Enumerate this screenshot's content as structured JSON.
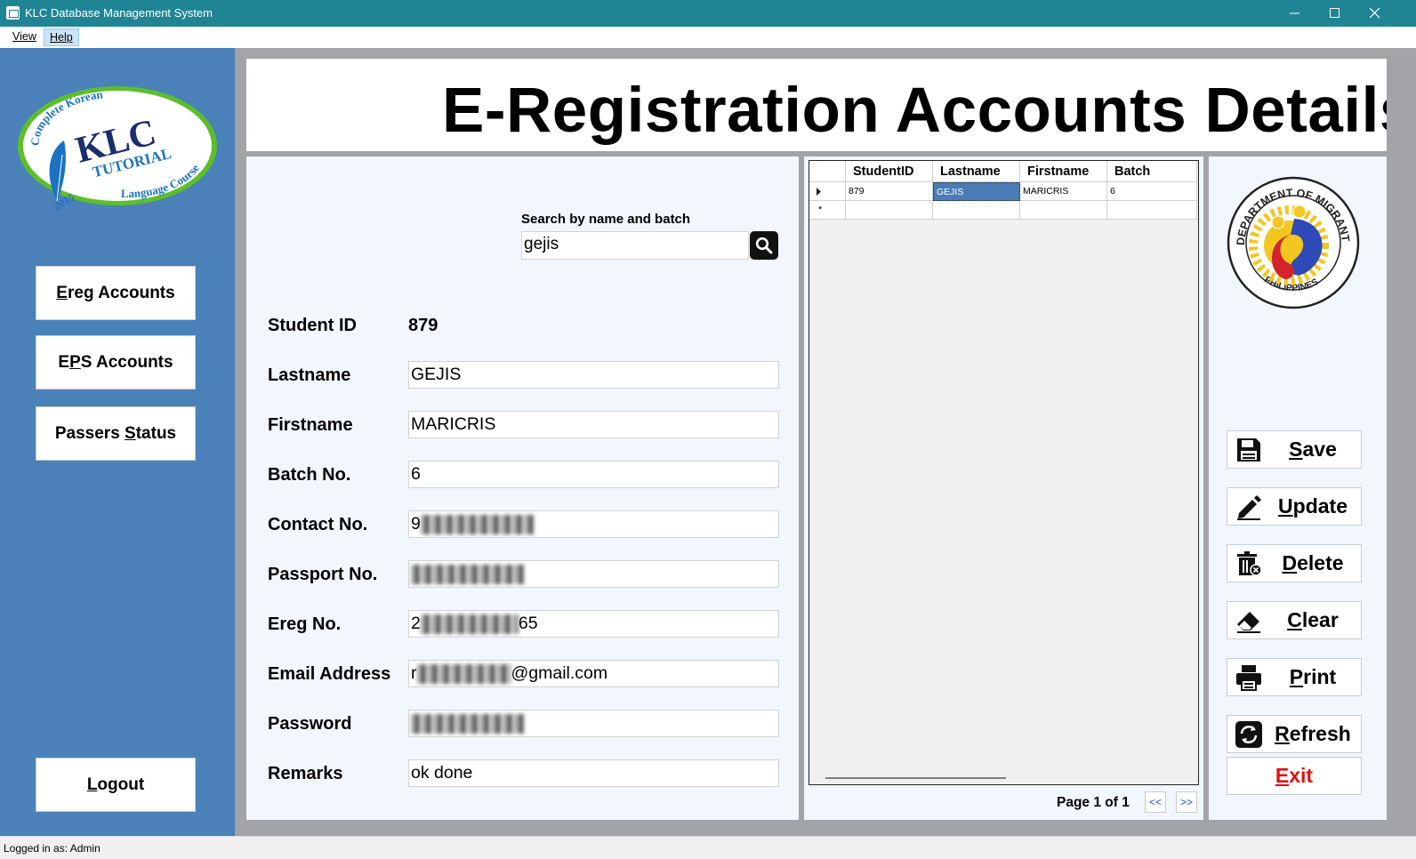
{
  "window": {
    "title": "KLC Database Management System"
  },
  "menu": {
    "view": "View",
    "help": "Help"
  },
  "sidebar": {
    "logo": {
      "arc_top": "Complete Korean",
      "main": "KLC",
      "sub": "TUTORIAL",
      "arc_bottom": "Language Course",
      "year": "2015"
    },
    "ereg_pre": "",
    "ereg_u": "E",
    "ereg_post": "reg Accounts",
    "eps_pre": "E",
    "eps_u": "P",
    "eps_post": "S Accounts",
    "passers_pre": "Passers ",
    "passers_u": "S",
    "passers_post": "tatus",
    "logout_pre": "",
    "logout_u": "L",
    "logout_post": "ogout"
  },
  "header": {
    "title": "E-Registration Accounts Details"
  },
  "search": {
    "label": "Search by name and batch",
    "value": "gejis"
  },
  "form": {
    "student_id_label": "Student ID",
    "student_id": "879",
    "lastname_label": "Lastname",
    "lastname": "GEJIS",
    "firstname_label": "Firstname",
    "firstname": "MARICRIS",
    "batch_label": "Batch No.",
    "batch": "6",
    "contact_label": "Contact No.",
    "contact": "9",
    "passport_label": "Passport No.",
    "passport": "",
    "ereg_label": "Ereg No.",
    "ereg_prefix": "2",
    "ereg_suffix": "65",
    "email_label": "Email Address",
    "email_prefix": "r",
    "email_suffix": "@gmail.com",
    "password_label": "Password",
    "password": "",
    "remarks_label": "Remarks",
    "remarks": "ok done"
  },
  "grid": {
    "columns": [
      "StudentID",
      "Lastname",
      "Firstname",
      "Batch"
    ],
    "rows": [
      [
        "879",
        "GEJIS",
        "MARICRIS",
        "6"
      ]
    ],
    "new_row_marker": "*"
  },
  "pager": {
    "text": "Page 1 of 1",
    "prev": "<<",
    "next": ">>"
  },
  "seal": {
    "ring_text": "DEPARTMENT OF MIGRANT WORKERS",
    "bottom_text": "PHILIPPINES"
  },
  "actions": {
    "save_u": "S",
    "save_post": "ave",
    "update_u": "U",
    "update_post": "pdate",
    "delete_u": "D",
    "delete_post": "elete",
    "clear_u": "C",
    "clear_post": "lear",
    "print_u": "P",
    "print_post": "rint",
    "refresh_u": "R",
    "refresh_post": "efresh",
    "exit_u": "E",
    "exit_post": "xit"
  },
  "status": {
    "text": "Logged in as: Admin"
  },
  "colors": {
    "titlebar": "#1f8595",
    "sidebar": "#4a81b9",
    "panel": "#f2f7fd",
    "exit": "#e01010",
    "selection": "#4b7cb5"
  }
}
